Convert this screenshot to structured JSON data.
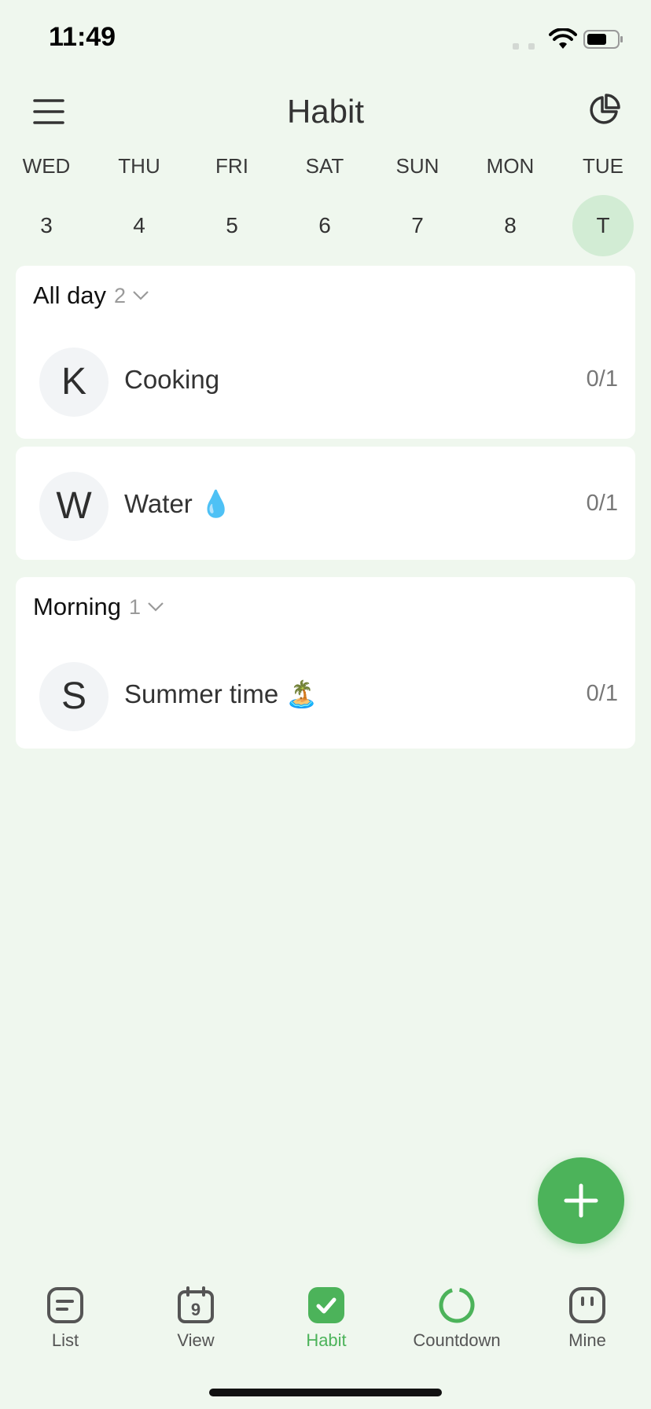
{
  "status_bar": {
    "time": "11:49"
  },
  "header": {
    "title": "Habit"
  },
  "week": [
    {
      "name": "WED",
      "date": "3"
    },
    {
      "name": "THU",
      "date": "4"
    },
    {
      "name": "FRI",
      "date": "5"
    },
    {
      "name": "SAT",
      "date": "6"
    },
    {
      "name": "SUN",
      "date": "7"
    },
    {
      "name": "MON",
      "date": "8"
    },
    {
      "name": "TUE",
      "date": "T",
      "selected": true
    }
  ],
  "sections": [
    {
      "title": "All day",
      "count": "2",
      "habits": [
        {
          "initial": "K",
          "name": "Cooking",
          "progress": "0/1"
        },
        {
          "initial": "W",
          "name": "Water 💧",
          "progress": "0/1"
        }
      ]
    },
    {
      "title": "Morning",
      "count": "1",
      "habits": [
        {
          "initial": "S",
          "name": "Summer time 🏝️",
          "progress": "0/1"
        }
      ]
    }
  ],
  "tabs": [
    {
      "label": "List",
      "icon": "list-icon"
    },
    {
      "label": "View",
      "icon": "calendar-icon",
      "badge": "9"
    },
    {
      "label": "Habit",
      "icon": "habit-check-icon",
      "active": true
    },
    {
      "label": "Countdown",
      "icon": "countdown-ring-icon"
    },
    {
      "label": "Mine",
      "icon": "mine-face-icon"
    }
  ],
  "colors": {
    "accent": "#4cb35a",
    "background": "#eff7ee",
    "selected_day": "#d2ecd4"
  }
}
